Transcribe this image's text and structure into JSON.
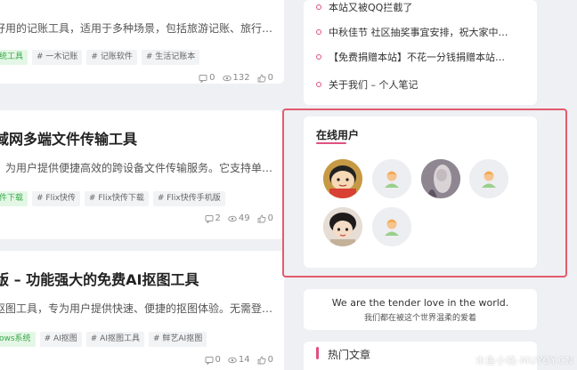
{
  "posts": [
    {
      "title": "",
      "excerpt": "好用的记账工具，适用于多种场景，包括旅游记账、旅行…",
      "tags": [
        {
          "label": "统工具",
          "green": true
        },
        {
          "label": "# 一木记账",
          "green": false
        },
        {
          "label": "# 记账软件",
          "green": false
        },
        {
          "label": "# 生活记账本",
          "green": false
        }
      ],
      "comments": "0",
      "views": "132",
      "likes": "0"
    },
    {
      "title": "域网多端文件传输工具",
      "excerpt": "，为用户提供便捷高效的跨设备文件传输服务。它支持单…",
      "tags": [
        {
          "label": "件下载",
          "green": true
        },
        {
          "label": "# Flix快传",
          "green": false
        },
        {
          "label": "# Flix快传下载",
          "green": false
        },
        {
          "label": "# Flix快传手机版",
          "green": false
        }
      ],
      "comments": "2",
      "views": "49",
      "likes": "0"
    },
    {
      "title": "版 – 功能强大的免费AI抠图工具",
      "excerpt": "抠图工具，专为用户提供快速、便捷的抠图体验。无需登…",
      "tags": [
        {
          "label": "ows系统",
          "green": true
        },
        {
          "label": "# AI抠图",
          "green": false
        },
        {
          "label": "# AI抠图工具",
          "green": false
        },
        {
          "label": "# 鲜艺AI抠图",
          "green": false
        }
      ],
      "comments": "0",
      "views": "14",
      "likes": "0"
    }
  ],
  "news": [
    "本站又被QQ拦截了",
    "中秋佳节 社区抽奖事宜安排，祝大家中…",
    "【免费捐赠本站】不花一分钱捐赠本站…",
    "关于我们 – 个人笔记"
  ],
  "online_users": {
    "title": "在线用户"
  },
  "quote": {
    "en": "We are the tender love in the world.",
    "cn": "我们都在被这个世界温柔的爱着"
  },
  "hot_articles": {
    "title": "热门文章"
  },
  "watermark": "木鱼小栈-MUYOY.CN",
  "colors": {
    "accent": "#e0507e",
    "highlight_border": "#e35a6c",
    "tag_green": "#39a84a",
    "page_bg": "#eef0f4"
  }
}
